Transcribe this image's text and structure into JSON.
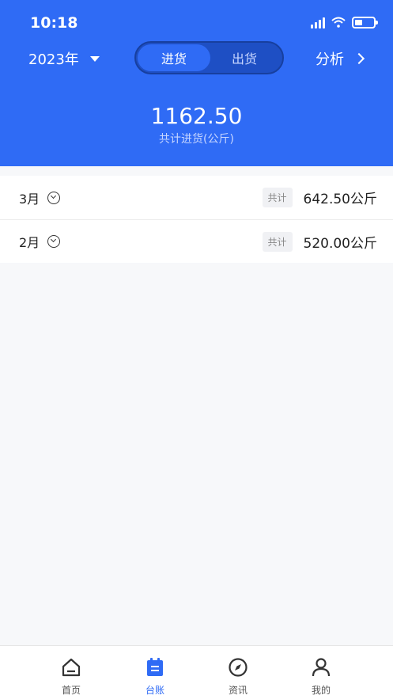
{
  "status": {
    "time": "10:18",
    "battery_level": 0.4
  },
  "header": {
    "year": "2023年",
    "segments": [
      {
        "label": "进货",
        "active": true
      },
      {
        "label": "出货",
        "active": false
      }
    ],
    "analysis_label": "分析",
    "total_value": "1162.50",
    "total_label": "共计进货(公斤)"
  },
  "months": [
    {
      "month": "3月",
      "tag": "共计",
      "amount": "642.50公斤"
    },
    {
      "month": "2月",
      "tag": "共计",
      "amount": "520.00公斤"
    }
  ],
  "tabbar": {
    "items": [
      {
        "label": "首页",
        "icon": "home-icon",
        "active": false
      },
      {
        "label": "台账",
        "icon": "ledger-icon",
        "active": true
      },
      {
        "label": "资讯",
        "icon": "compass-icon",
        "active": false
      },
      {
        "label": "我的",
        "icon": "user-icon",
        "active": false
      }
    ]
  },
  "colors": {
    "primary": "#2f6bf5",
    "background": "#f7f8fa"
  }
}
